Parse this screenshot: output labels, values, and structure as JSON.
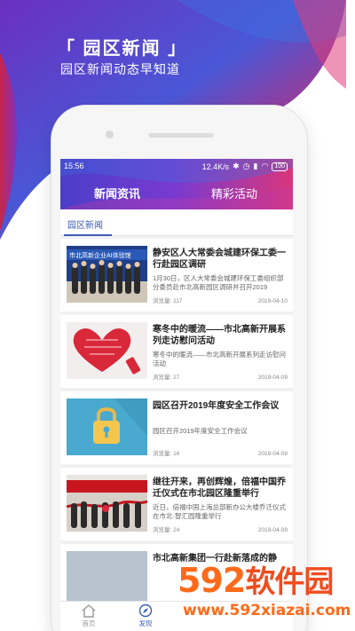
{
  "promo": {
    "headline": "「 园区新闻 」",
    "subline": "园区新闻动态早知道"
  },
  "status_bar": {
    "time": "15:56",
    "speed": "12.4K/s",
    "battery": "100"
  },
  "top_tabs": [
    {
      "label": "新闻资讯",
      "active": true
    },
    {
      "label": "精彩活动",
      "active": false
    }
  ],
  "sub_tab": {
    "label": "园区新闻"
  },
  "news": [
    {
      "title": "静安区人大常委会城建环保工委一行赴园区调研",
      "desc": "1月30日，区人大常委会城建环保工委组织部分委员赴市北高新园区调研并召开2019",
      "views": "浏览量: 117",
      "date": "2019-04-10",
      "thumb_caption": "市北高新企业AI体验馆"
    },
    {
      "title": "寒冬中的暖流——市北高新开展系列走访慰问活动",
      "desc": "寒冬中的暖流——市北高新开展系列走访慰问活动",
      "views": "浏览量: 27",
      "date": "2019-04-09"
    },
    {
      "title": "园区召开2019年度安全工作会议",
      "desc": "园区召开2019年度安全工作会议",
      "views": "浏览量: 16",
      "date": "2019-04-09"
    },
    {
      "title": "继往开来，再创辉煌，倍福中国乔迁仪式在市北园区隆重举行",
      "desc": "近日，倍福中国上海总部新办公大楼乔迁仪式在市北·智汇园隆重举行",
      "views": "浏览量: 24",
      "date": "2019-04-09"
    },
    {
      "title": "市北高新集团一行赴新落成的静",
      "desc": "",
      "views": "",
      "date": ""
    }
  ],
  "bottom_nav": [
    {
      "label": "首页",
      "icon": "home-icon",
      "active": false
    },
    {
      "label": "发现",
      "icon": "discover-icon",
      "active": true
    }
  ],
  "watermark": {
    "number": "592",
    "name": "软件园",
    "url": "www.592xiazai.com"
  },
  "colors": {
    "accent_blue": "#3c5db5",
    "promo_red": "#d81f3f",
    "promo_purple": "#6a3fc4",
    "watermark_orange": "#ff6a1a"
  }
}
